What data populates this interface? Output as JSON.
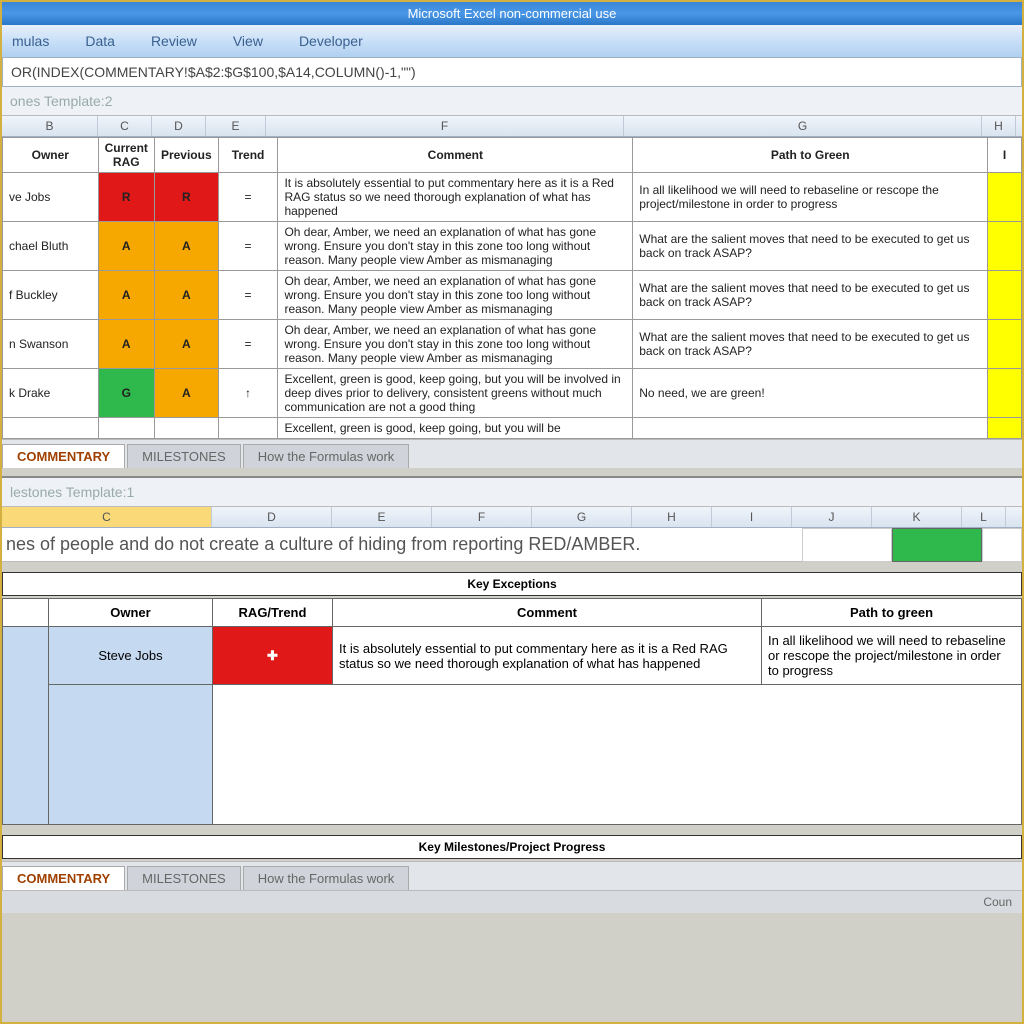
{
  "app": {
    "title": "Microsoft Excel non-commercial use"
  },
  "ribbon": {
    "m_formulas": "mulas",
    "m_data": "Data",
    "m_review": "Review",
    "m_view": "View",
    "m_developer": "Developer"
  },
  "formula_bar": "OR(INDEX(COMMENTARY!$A$2:$G$100,$A14,COLUMN()-1,\"\")",
  "doc1": "ones Template:2",
  "cols1": {
    "b": "B",
    "c": "C",
    "d": "D",
    "e": "E",
    "f": "F",
    "g": "G",
    "h": "H"
  },
  "headers1": {
    "owner": "Owner",
    "current": "Current RAG",
    "prev": "Previous",
    "trend": "Trend",
    "comment": "Comment",
    "path": "Path to Green",
    "i": "I"
  },
  "rows1": [
    {
      "owner": "ve Jobs",
      "c": "R",
      "d": "R",
      "t": "=",
      "comment": "It is absolutely essential to put commentary here as it is a Red RAG status so we need thorough explanation of what has happened",
      "path": "In all likelihood we will need to rebaseline or rescope the project/milestone in order to progress",
      "cc": "red",
      "dc": "red"
    },
    {
      "owner": "chael Bluth",
      "c": "A",
      "d": "A",
      "t": "=",
      "comment": "Oh dear, Amber, we need an explanation of what has gone wrong. Ensure you don't stay in this zone too long without reason. Many people view Amber as mismanaging",
      "path": "What are the salient moves that need to be executed to get us back on track ASAP?",
      "cc": "amber",
      "dc": "amber"
    },
    {
      "owner": "f Buckley",
      "c": "A",
      "d": "A",
      "t": "=",
      "comment": "Oh dear, Amber, we need an explanation of what has gone wrong. Ensure you don't stay in this zone too long without reason. Many people view Amber as mismanaging",
      "path": "What are the salient moves that need to be executed to get us back on track ASAP?",
      "cc": "amber",
      "dc": "amber"
    },
    {
      "owner": "n Swanson",
      "c": "A",
      "d": "A",
      "t": "=",
      "comment": "Oh dear, Amber, we need an explanation of what has gone wrong. Ensure you don't stay in this zone too long without reason. Many people view Amber as mismanaging",
      "path": "What are the salient moves that need to be executed to get us back on track ASAP?",
      "cc": "amber",
      "dc": "amber"
    },
    {
      "owner": "k Drake",
      "c": "G",
      "d": "A",
      "t": "↑",
      "comment": "Excellent, green is good, keep going, but you will be involved in deep dives prior to delivery, consistent greens without much communication are not a good thing",
      "path": "No need, we are green!",
      "cc": "green",
      "dc": "amber"
    },
    {
      "owner": "",
      "c": "",
      "d": "",
      "t": "",
      "comment": "Excellent, green is good, keep going, but you will be",
      "path": "",
      "cc": "",
      "dc": ""
    }
  ],
  "tabs": {
    "commentary": "COMMENTARY",
    "milestones": "MILESTONES",
    "how": "How the Formulas work"
  },
  "doc2": "lestones Template:1",
  "cols2": {
    "c": "C",
    "d": "D",
    "e": "E",
    "f": "F",
    "g": "G",
    "h": "H",
    "i": "I",
    "j": "J",
    "k": "K",
    "l": "L"
  },
  "toptext": "nes of people and do not create a culture of hiding from reporting RED/AMBER.",
  "sect1": "Key Exceptions",
  "headers2": {
    "owner": "Owner",
    "rag": "RAG/Trend",
    "comment": "Comment",
    "path": "Path to green"
  },
  "row2": {
    "owner": "Steve Jobs",
    "rag": "✚",
    "comment": "It is absolutely essential to put commentary here as it is a Red RAG status so we need thorough explanation of what has happened",
    "path": "In all likelihood we will need to rebaseline or rescope the project/milestone in order to progress"
  },
  "sect2": "Key Milestones/Project Progress",
  "status": "Coun"
}
